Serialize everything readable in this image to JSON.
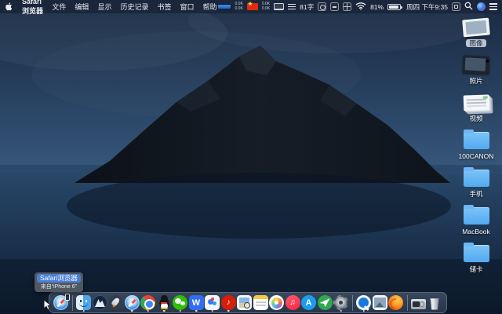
{
  "menu_bar": {
    "app_name": "Safari浏览器",
    "menus": [
      "文件",
      "编辑",
      "显示",
      "历史记录",
      "书签",
      "窗口",
      "帮助"
    ],
    "status": {
      "net_lines_left": [
        "0.0K",
        "0.0K"
      ],
      "net_lines_right": [
        "0.0K",
        "0.0K"
      ],
      "word_count": "81字",
      "battery_percent": "81%",
      "clock": "周四 下午9:35"
    }
  },
  "desktop": {
    "icons": [
      {
        "label": "图像"
      },
      {
        "label": "照片"
      },
      {
        "label": "视频"
      },
      {
        "label": "100CANON"
      },
      {
        "label": "手机"
      },
      {
        "label": "MacBook"
      },
      {
        "label": "储卡"
      }
    ]
  },
  "dock": {
    "tooltip": {
      "title": "Safari浏览器",
      "subtitle": "来自“iPhone 6”"
    },
    "glyphs": {
      "wps": "W",
      "appstore": "A",
      "netease_note": "♪",
      "music_note": "♫"
    }
  },
  "colors": {
    "folder_blue": "#53a9f0",
    "menubar_bg": "#1a263a",
    "tooltip_highlight": "#4a7fd6",
    "flag_red": "#dd2a10"
  }
}
